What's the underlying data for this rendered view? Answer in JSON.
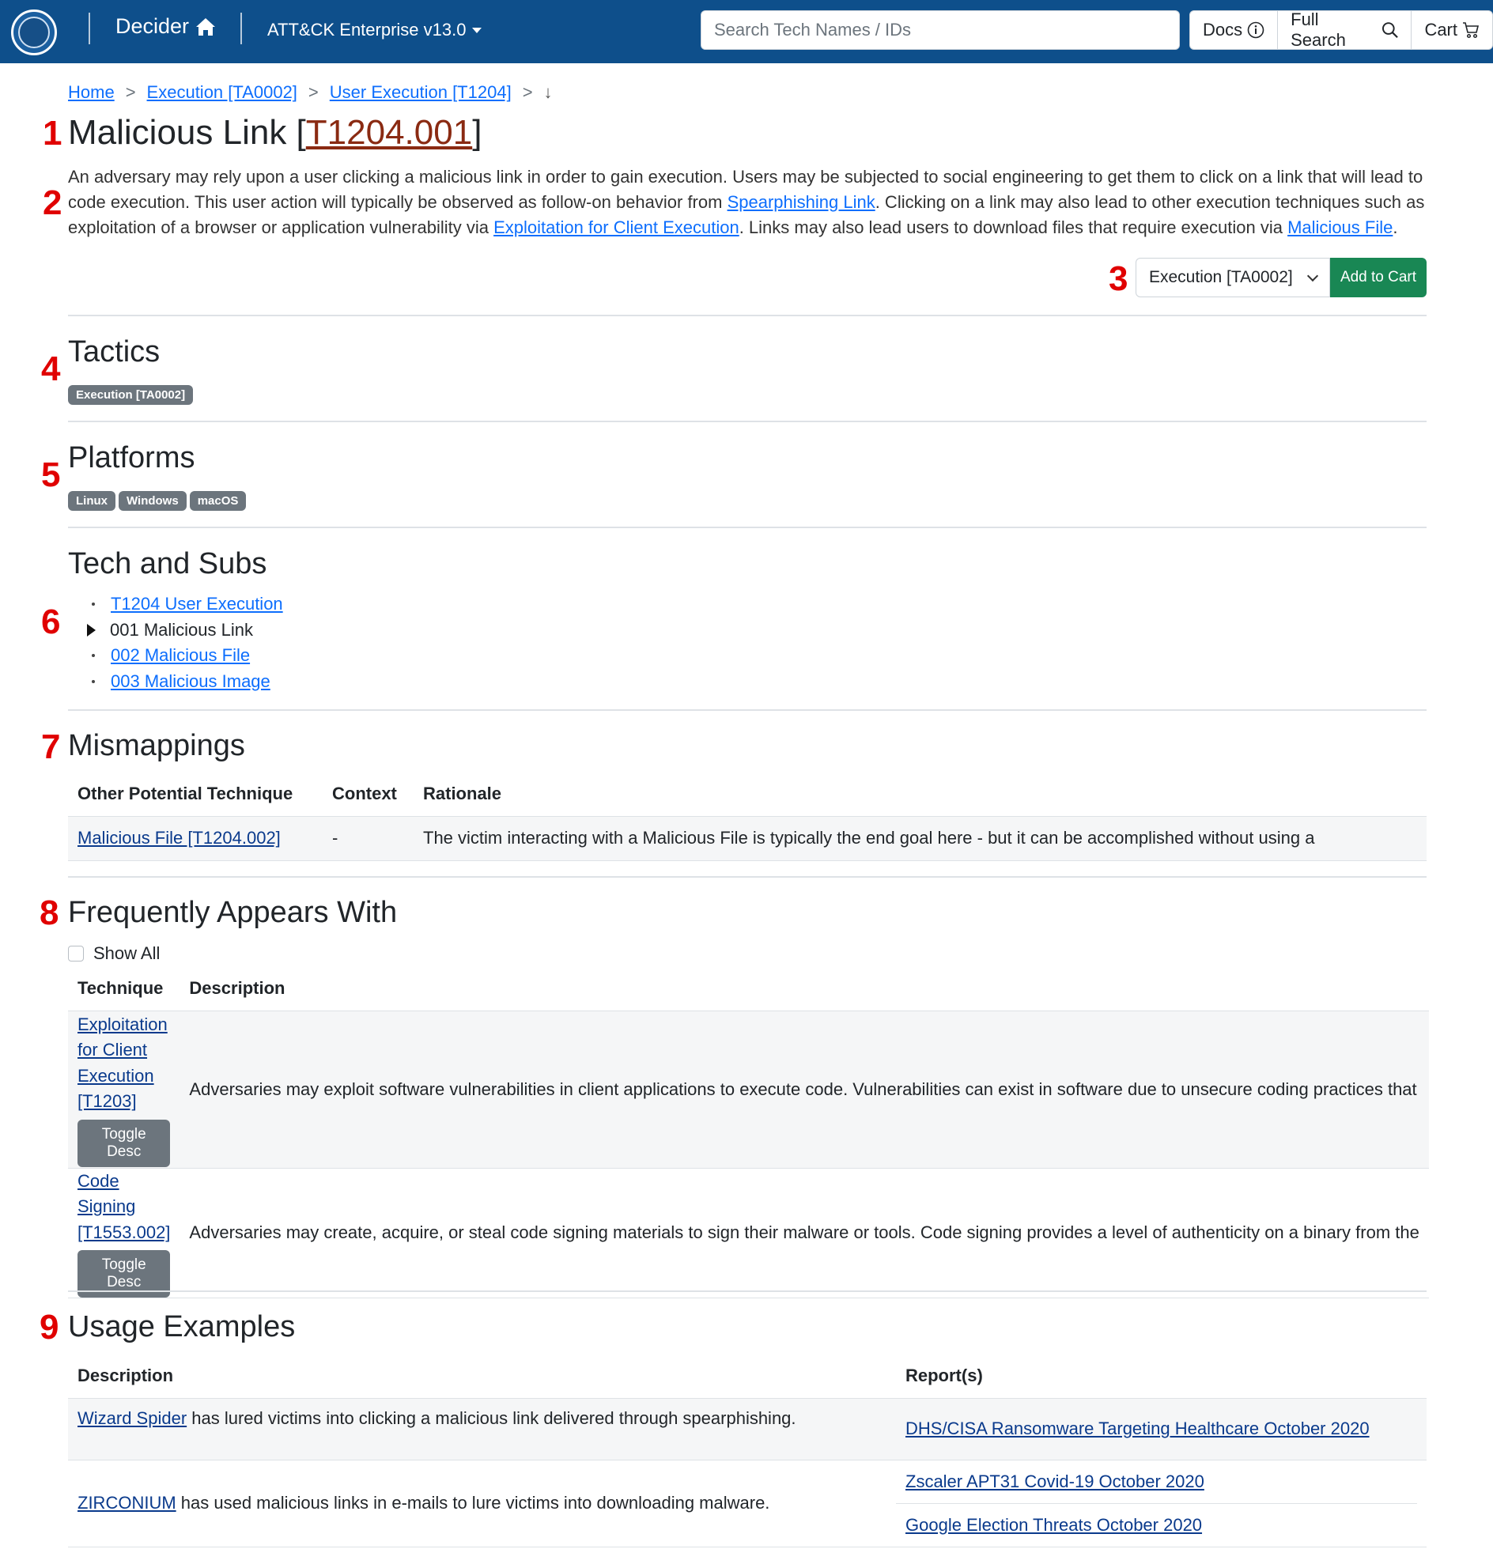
{
  "navbar": {
    "brand": "Decider",
    "matrix_dropdown": "ATT&CK Enterprise v13.0",
    "search_placeholder": "Search Tech Names / IDs",
    "docs": "Docs",
    "full_search": "Full Search",
    "cart": "Cart"
  },
  "breadcrumb": {
    "home": "Home",
    "sep": ">",
    "tactic": "Execution [TA0002]",
    "technique": "User Execution [T1204]",
    "down": "↓"
  },
  "markers": [
    "1",
    "2",
    "3",
    "4",
    "5",
    "6",
    "7",
    "8",
    "9"
  ],
  "page": {
    "title_prefix": "Malicious Link [",
    "title_id": "T1204.001",
    "title_suffix": "]",
    "desc_1": "An adversary may rely upon a user clicking a malicious link in order to gain execution. Users may be subjected to social engineering to get them to click on a link that will lead to code execution. This user action will typically be observed as follow-on behavior from ",
    "link_spearphishing": "Spearphishing Link",
    "desc_2": ". Clicking on a link may also lead to other execution techniques such as exploitation of a browser or application vulnerability via ",
    "link_exploitation": "Exploitation for Client Execution",
    "desc_3": ". Links may also lead users to download files that require execution via ",
    "link_malfile": "Malicious File",
    "desc_4": "."
  },
  "cart_bar": {
    "selected_tactic": "Execution [TA0002]",
    "add_button": "Add to Cart"
  },
  "tactics": {
    "heading": "Tactics",
    "items": [
      "Execution [TA0002]"
    ]
  },
  "platforms": {
    "heading": "Platforms",
    "items": [
      "Linux",
      "Windows",
      "macOS"
    ]
  },
  "tech_subs": {
    "heading": "Tech and Subs",
    "items": [
      "T1204 User Execution",
      "001 Malicious Link",
      "002 Malicious File",
      "003 Malicious Image"
    ]
  },
  "mismappings": {
    "heading": "Mismappings",
    "columns": [
      "Other Potential Technique",
      "Context",
      "Rationale"
    ],
    "rows": [
      {
        "technique": "Malicious File [T1204.002]",
        "context": "-",
        "rationale": "The victim interacting with a Malicious File is typically the end goal here - but it can be accomplished without using a"
      }
    ]
  },
  "frequent": {
    "heading": "Frequently Appears With",
    "show_all": "Show All",
    "columns": [
      "Technique",
      "Description"
    ],
    "toggle_label": "Toggle Desc",
    "rows": [
      {
        "technique": "Exploitation for Client Execution [T1203]",
        "description": "Adversaries may exploit software vulnerabilities in client applications to execute code. Vulnerabilities can exist in software due to unsecure coding practices that"
      },
      {
        "technique": "Code Signing [T1553.002]",
        "description": "Adversaries may create, acquire, or steal code signing materials to sign their malware or tools. Code signing provides a level of authenticity on a binary from the"
      }
    ]
  },
  "usage": {
    "heading": "Usage Examples",
    "columns": [
      "Description",
      "Report(s)"
    ],
    "rows": [
      {
        "actor": "Wizard Spider",
        "text": " has lured victims into clicking a malicious link delivered through spearphishing.",
        "reports": [
          "DHS/CISA Ransomware Targeting Healthcare October 2020"
        ]
      },
      {
        "actor": "ZIRCONIUM",
        "text": " has used malicious links in e-mails to lure victims into downloading malware.",
        "reports": [
          "Zscaler APT31 Covid-19 October 2020",
          "Google Election Threats October 2020"
        ]
      }
    ]
  },
  "colors": {
    "navbar": "#0e4f8b",
    "add_button": "#198754",
    "badge": "#6c757d",
    "marker": "#e00000",
    "title_link": "#8a2a12"
  }
}
